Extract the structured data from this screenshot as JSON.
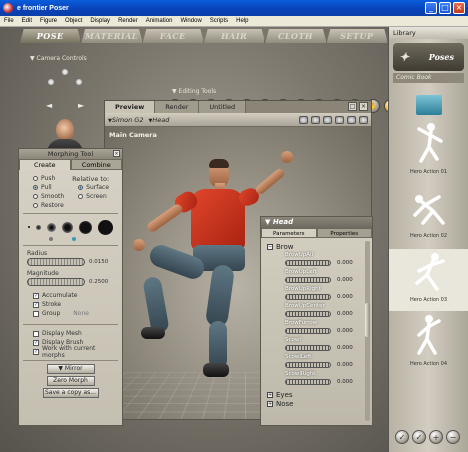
{
  "window": {
    "title": "e frontier Poser",
    "min": "_",
    "max": "□",
    "close": "×"
  },
  "menu": [
    "File",
    "Edit",
    "Figure",
    "Object",
    "Display",
    "Render",
    "Animation",
    "Window",
    "Scripts",
    "Help"
  ],
  "rooms": [
    "POSE",
    "MATERIAL",
    "FACE",
    "HAIR",
    "CLOTH",
    "SETUP"
  ],
  "camera_controls": {
    "label": "Camera Controls"
  },
  "editing_tools": {
    "label": "Editing Tools"
  },
  "document": {
    "tabs": [
      "Preview",
      "Render",
      "Untitled"
    ],
    "figure": "Simon G2",
    "actor": "Head",
    "camera": "Main Camera"
  },
  "morphing_tool": {
    "title": "Morphing Tool",
    "tabs": [
      "Create",
      "Combine"
    ],
    "modes": [
      "Push",
      "Pull",
      "Smooth",
      "Restore"
    ],
    "relative_label": "Relative to:",
    "relative": [
      "Surface",
      "Screen"
    ],
    "radius_label": "Radius",
    "radius_value": "0.0150",
    "magnitude_label": "Magnitude",
    "magnitude_value": "0.2500",
    "accumulate": "Accumulate",
    "stroke": "Stroke",
    "group": "Group",
    "group_value": "None",
    "display_mesh": "Display Mesh",
    "display_brush": "Display Brush",
    "work_current": "Work with current morphs",
    "btn_mirror": "Mirror",
    "btn_zero": "Zero Morph",
    "btn_save": "Save a copy as..."
  },
  "parameters": {
    "title": "Head",
    "tabs": [
      "Parameters",
      "Properties"
    ],
    "group_brow": "Brow",
    "dials": [
      {
        "name": "BrowUpAll",
        "value": "0.000"
      },
      {
        "name": "BrowUpLeft",
        "value": "0.000"
      },
      {
        "name": "BrowUpRight",
        "value": "0.000"
      },
      {
        "name": "BrowUpCenter",
        "value": "0.000"
      },
      {
        "name": "BrowFurrow",
        "value": "0.000"
      },
      {
        "name": "Scowl",
        "value": "0.000"
      },
      {
        "name": "ScowlLeft",
        "value": "0.000"
      },
      {
        "name": "ScowlRight",
        "value": "0.000"
      }
    ],
    "group_eyes": "Eyes",
    "group_nose": "Nose"
  },
  "library": {
    "header": "Library",
    "category": "Poses",
    "subfolder": "Comic Book",
    "items": [
      "Hero Action 01",
      "Hero Action 02",
      "Hero Action 03",
      "Hero Action 04"
    ]
  },
  "colors": {
    "titlebar": "#0a5ddb",
    "shirt": "#d23a22",
    "selection": "#1c5ca8"
  }
}
